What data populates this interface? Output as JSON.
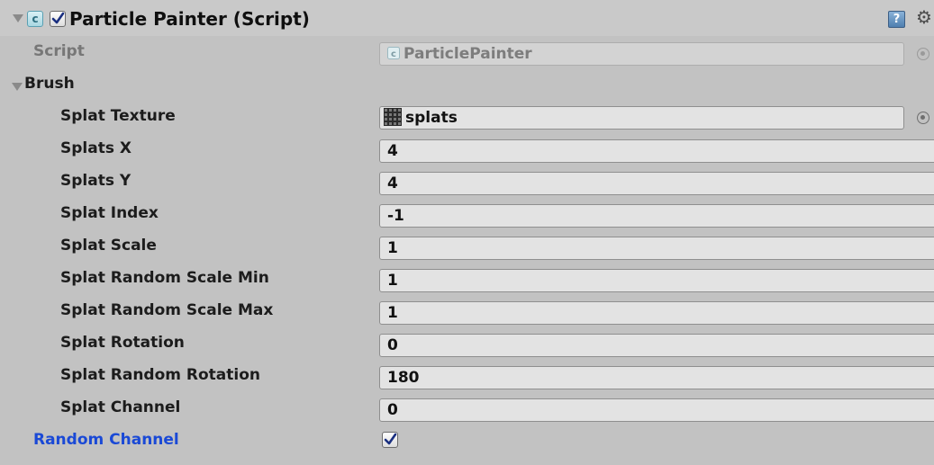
{
  "component": {
    "title": "Particle Painter (Script)",
    "enabled": true,
    "script_label": "Script",
    "script_value": "ParticlePainter"
  },
  "brush": {
    "label": "Brush",
    "expanded": true,
    "splat_texture": {
      "label": "Splat Texture",
      "value": "splats"
    },
    "fields": [
      {
        "label": "Splats X",
        "value": "4"
      },
      {
        "label": "Splats Y",
        "value": "4"
      },
      {
        "label": "Splat Index",
        "value": "-1"
      },
      {
        "label": "Splat Scale",
        "value": "1"
      },
      {
        "label": "Splat Random Scale Min",
        "value": "1"
      },
      {
        "label": "Splat Random Scale Max",
        "value": "1"
      },
      {
        "label": "Splat Rotation",
        "value": "0"
      },
      {
        "label": "Splat Random Rotation",
        "value": "180"
      },
      {
        "label": "Splat Channel",
        "value": "0"
      }
    ]
  },
  "random_channel": {
    "label": "Random Channel",
    "checked": true
  },
  "icons": {
    "header_foldout": "triangle-down-icon",
    "script_type": "csharp-script-icon",
    "help": "help-book-icon",
    "settings": "gear-icon",
    "object_picker": "object-picker-icon",
    "texture": "texture-icon"
  },
  "colors": {
    "panel_bg": "#c2c2c2",
    "field_bg": "#e3e3e3",
    "prefab_override_blue": "#1a49d6"
  }
}
